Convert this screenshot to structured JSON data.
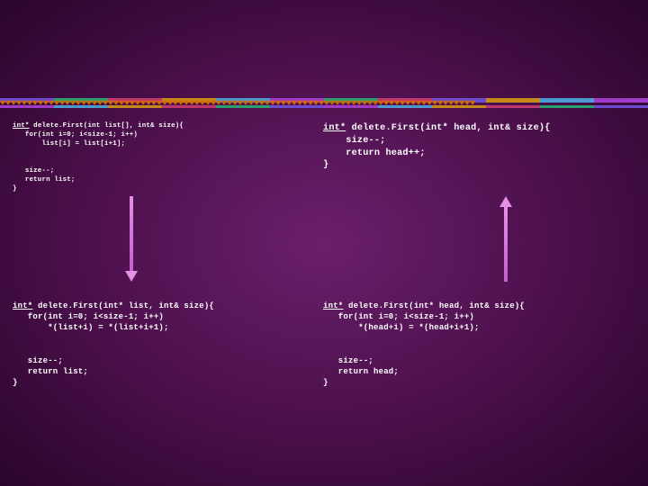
{
  "decoration": {
    "hearts_row": "♥♥♥♥♥♥♥♥♥♥♥♥♥♥♥♥♥♥♥♥♥♥♥♥♥♥♥♥♥♥♥♥♥♥♥♥♥♥♥♥♥♥♥♥♥♥♥♥♥♥♥♥♥♥♥♥♥♥♥♥♥♥♥♥♥♥♥♥♥♥♥♥♥♥♥♥♥♥♥♥♥♥♥♥♥♥♥♥"
  },
  "blocks": {
    "top_left": {
      "kw": "int*",
      "sig": " delete.First(int list[], int& size){",
      "body": "\n   for(int i=0; i<size-1; i++)\n       list[i] = list[i+1];\n\n\n   size--;\n   return list;\n}"
    },
    "top_right": {
      "kw": "int*",
      "sig": " delete.First(int* head, int& size){",
      "body": "\n    size--;\n    return head++;\n}"
    },
    "bottom_left": {
      "kw": "int*",
      "sig": " delete.First(int* list, int& size){",
      "body": "\n   for(int i=0; i<size-1; i++)\n       *(list+i) = *(list+i+1);\n\n\n   size--;\n   return list;\n}"
    },
    "bottom_right": {
      "kw": "int*",
      "sig": " delete.First(int* head, int& size){",
      "body": "\n   for(int i=0; i<size-1; i++)\n       *(head+i) = *(head+i+1);\n\n\n   size--;\n   return head;\n}"
    }
  }
}
